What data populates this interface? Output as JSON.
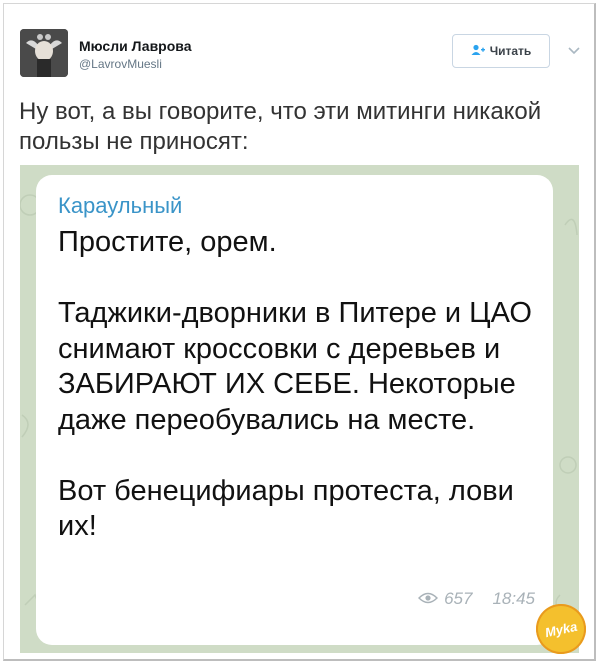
{
  "author": {
    "name": "Мюсли Лаврова",
    "handle": "@LavrovMuesli",
    "avatar_icon": "double-headed-eagle-avatar"
  },
  "follow_button": {
    "icon": "add-user-icon",
    "label": "Читать"
  },
  "more_icon": "chevron-down-icon",
  "tweet": {
    "text": "Ну вот, а вы говорите, что эти митинги никакой пользы не приносят:"
  },
  "message": {
    "sender": "Караульный",
    "body": "Простите, орем.\n\nТаджики-дворники в Питере и ЦАО снимают кроссовки с деревьев и ЗАБИРАЮТ ИХ СЕБЕ. Некоторые даже переобувались на месте.\n\nВот бенецифиары протеста, лови их!",
    "views": "657",
    "time": "18:45",
    "views_icon": "eye-icon"
  },
  "watermark": {
    "text": "Mykа"
  },
  "colors": {
    "sender_blue": "#3a94c8",
    "chat_background": "#cfdcc6",
    "follow_icon_blue": "#2aa3ef"
  }
}
